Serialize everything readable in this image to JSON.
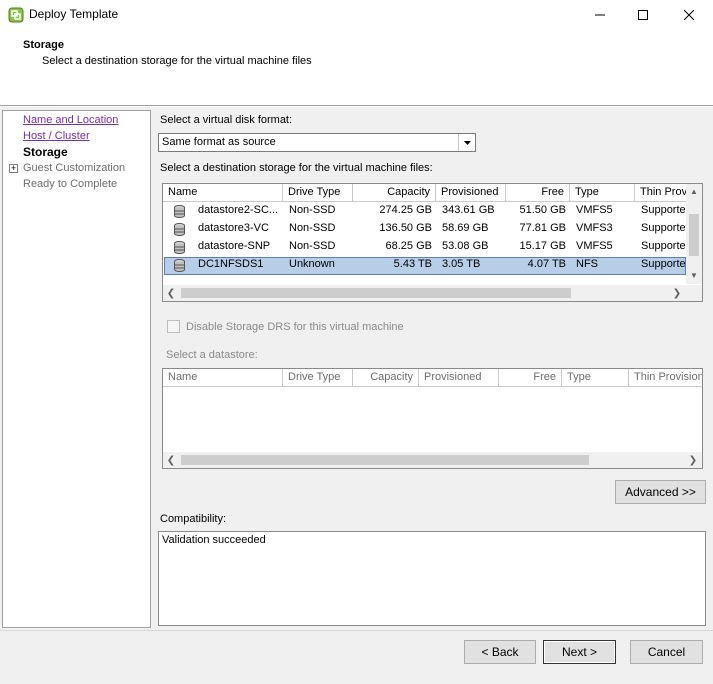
{
  "window": {
    "title": "Deploy Template",
    "controls": {
      "minimize": "—",
      "maximize": "☐",
      "close": "✕"
    }
  },
  "header": {
    "title": "Storage",
    "subtitle": "Select a destination storage for the virtual machine files"
  },
  "nav": {
    "items": [
      {
        "label": "Name and Location",
        "state": "link"
      },
      {
        "label": "Host / Cluster",
        "state": "link"
      },
      {
        "label": "Storage",
        "state": "current"
      },
      {
        "label": "Guest Customization",
        "state": "disabled"
      },
      {
        "label": "Ready to Complete",
        "state": "disabled"
      }
    ],
    "expander": "+"
  },
  "disk_format": {
    "label": "Select a virtual disk format:",
    "value": "Same format as source"
  },
  "dest_storage": {
    "label": "Select a destination storage for the virtual machine files:",
    "columns": [
      "Name",
      "Drive Type",
      "Capacity",
      "Provisioned",
      "Free",
      "Type",
      "Thin Prov"
    ],
    "rows": [
      {
        "name": "datastore2-SC...",
        "drive": "Non-SSD",
        "capacity": "274.25 GB",
        "provisioned": "343.61 GB",
        "free": "51.50 GB",
        "type": "VMFS5",
        "thin": "Supporte",
        "selected": false
      },
      {
        "name": "datastore3-VC",
        "drive": "Non-SSD",
        "capacity": "136.50 GB",
        "provisioned": "58.69 GB",
        "free": "77.81 GB",
        "type": "VMFS3",
        "thin": "Supporte",
        "selected": false
      },
      {
        "name": "datastore-SNP",
        "drive": "Non-SSD",
        "capacity": "68.25 GB",
        "provisioned": "53.08 GB",
        "free": "15.17 GB",
        "type": "VMFS5",
        "thin": "Supporte",
        "selected": false
      },
      {
        "name": "DC1NFSDS1",
        "drive": "Unknown",
        "capacity": "5.43 TB",
        "provisioned": "3.05 TB",
        "free": "4.07 TB",
        "type": "NFS",
        "thin": "Supporte",
        "selected": true
      }
    ]
  },
  "drs": {
    "checkbox_label": "Disable Storage DRS for this virtual machine",
    "checked": false
  },
  "datastore_select": {
    "label": "Select a datastore:",
    "columns": [
      "Name",
      "Drive Type",
      "Capacity",
      "Provisioned",
      "Free",
      "Type",
      "Thin Provision"
    ]
  },
  "buttons": {
    "advanced": "Advanced >>",
    "back": "< Back",
    "next": "Next >",
    "cancel": "Cancel"
  },
  "compatibility": {
    "label": "Compatibility:",
    "message": "Validation succeeded"
  },
  "colors": {
    "link": "#7b2ca6",
    "selection": "#b8cde8",
    "app_icon": "#7cb342"
  },
  "icons": {
    "app": "vsphere-app-icon",
    "datastore": "datastore-icon"
  }
}
